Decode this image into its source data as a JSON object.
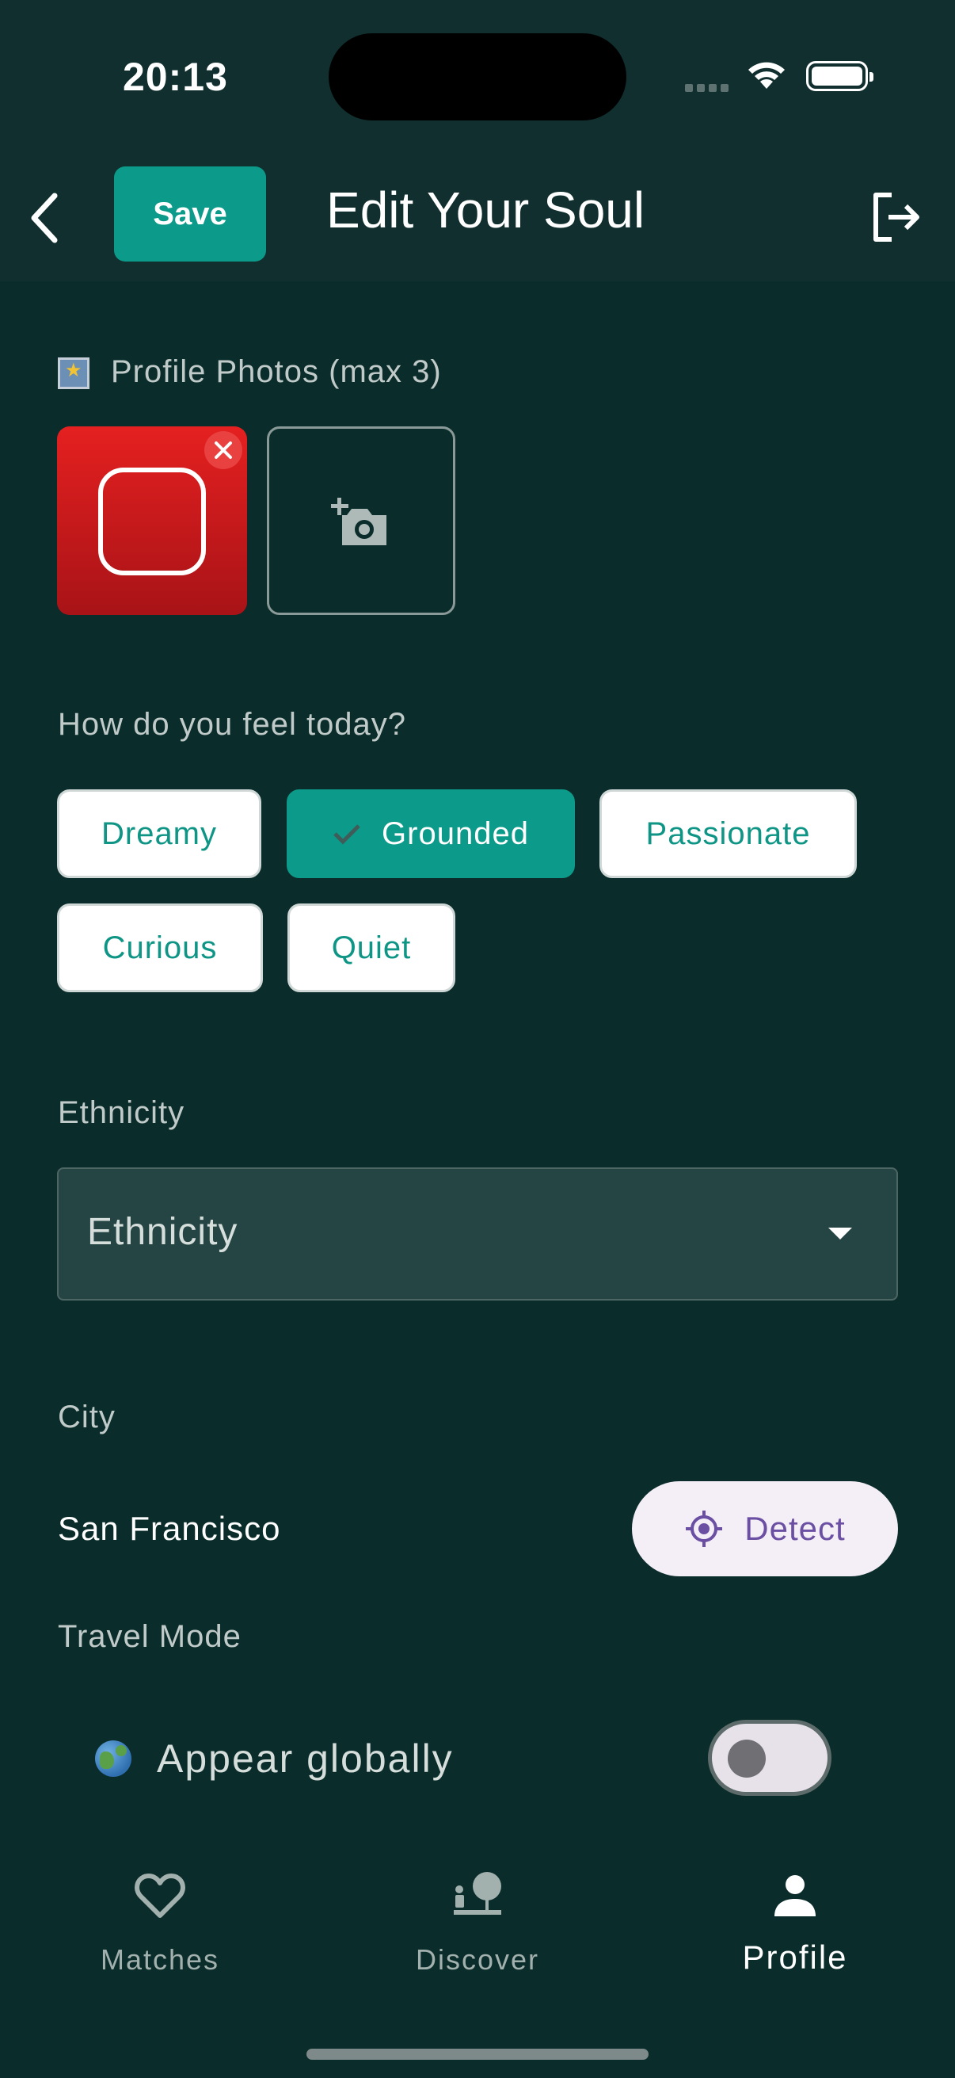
{
  "status_bar": {
    "time": "20:13"
  },
  "header": {
    "save_label": "Save",
    "title": "Edit Your Soul"
  },
  "photos": {
    "label": "Profile Photos (max 3)",
    "count": 1
  },
  "mood": {
    "label": "How do you feel today?",
    "options": [
      "Dreamy",
      "Grounded",
      "Passionate",
      "Curious",
      "Quiet"
    ],
    "selected": "Grounded"
  },
  "ethnicity": {
    "label": "Ethnicity",
    "placeholder": "Ethnicity"
  },
  "city": {
    "label": "City",
    "value": "San Francisco",
    "detect_label": "Detect"
  },
  "travel": {
    "label": "Travel Mode",
    "toggle_label": "Appear globally",
    "enabled": false
  },
  "nav": {
    "items": [
      {
        "label": "Matches",
        "icon": "heart-icon"
      },
      {
        "label": "Discover",
        "icon": "discover-icon"
      },
      {
        "label": "Profile",
        "icon": "person-icon"
      }
    ],
    "active": "Profile"
  },
  "colors": {
    "accent": "#0c9b8a",
    "background": "#0a2c2a",
    "detect_text": "#6b4fa2"
  }
}
